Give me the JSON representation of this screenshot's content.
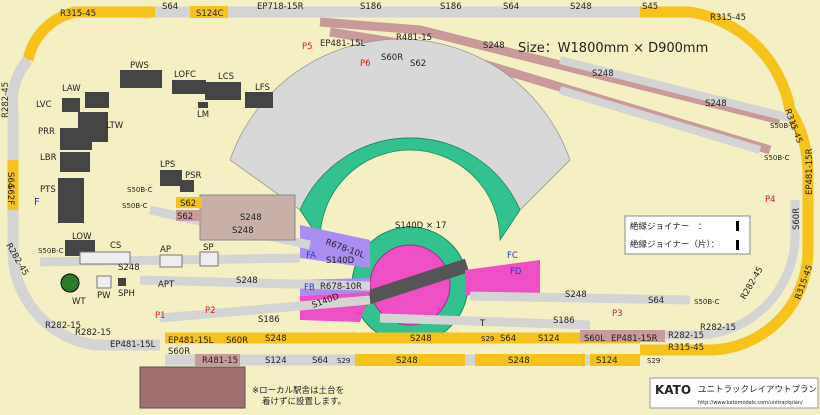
{
  "board": {
    "size_text": "Size：W1800mm × D900mm",
    "note_line1": "※ローカル駅舎は土台を",
    "note_line2": "着けずに設置します。"
  },
  "legend": {
    "joiner_insulated": "絶縁ジョイナー　：",
    "joiner_insulated_one": "絶縁ジョイナー（片）："
  },
  "brand": {
    "logo": "KATO",
    "title": "ユニトラックレイアウトプラン",
    "url": "http://www.katomodels.com/unitrackplan/"
  },
  "track_labels": {
    "r315_tl": "R315-45",
    "s64_top": "S64",
    "s124c": "S124C",
    "ep718": "EP718-15R",
    "s186_top1": "S186",
    "s186_top2": "S186",
    "s64_top2": "S64",
    "s248_top": "S248",
    "s45": "S45",
    "r315_tr": "R315-45",
    "r315_r": "R315-45",
    "r315_br": "R315-45",
    "r282_l": "R282-45",
    "s64_l": "S64",
    "s62f": "S62F",
    "r282_bl": "R282-45",
    "r282_15a": "R282-15",
    "r282_15b": "R282-15",
    "ep481_bl": "EP481-15L",
    "s60r_b": "S60R",
    "r481_b": "R481-15",
    "s124_b": "S124",
    "s64_b": "S64",
    "s29_b": "S29",
    "s248_b1": "S248",
    "s248_b2": "S248",
    "s124_b2": "S124",
    "s29_b2": "S29",
    "s248_mid1": "S248",
    "s248_mid2": "S248",
    "s29_m": "S29",
    "s64_m": "S64",
    "s124_m": "S124",
    "s60l": "S60L",
    "ep481_r": "EP481-15R",
    "r282_15r1": "R282-15",
    "r282_15r2": "R282-15",
    "r282_45r": "R282-45",
    "s60r_r": "S60R",
    "ep481_r2": "EP481-15R",
    "ep481_15l_top": "EP481-15L",
    "r481_top": "R481-15",
    "s60r_top": "S60R",
    "s62_top": "S62",
    "s248_d1": "S248",
    "s248_d2": "S248",
    "s248_d3": "S248",
    "s50bc_r1": "S50B-C",
    "s50bc_r2": "S50B-C",
    "s50bc_l1": "S50B-C",
    "s50bc_l2": "S50B-C",
    "s50bc_l3": "S50B-C",
    "s50bc_rb": "S50B-C",
    "s62_y": "S62",
    "s62_p": "S62",
    "s248_y1": "S248",
    "s248_y2": "S248",
    "s248_y3": "S248",
    "s248_cs": "S248",
    "s186_cs": "S186",
    "s186_r": "S186",
    "s248_r1": "S248",
    "s64_r": "S64",
    "ep481_15l_b": "EP481-15L",
    "s60r_b2": "S60R",
    "r678_10l": "R678-10L",
    "r678_10r": "R678-10R",
    "s140d_1": "S140D",
    "s140d_2": "S140D",
    "turntable": "S140D × 17",
    "fa": "FA",
    "fb": "FB",
    "fc": "FC",
    "fd": "FD",
    "t": "T",
    "f": "F"
  },
  "power_labels": [
    "P1",
    "P2",
    "P3",
    "P4",
    "P5",
    "P6"
  ],
  "structures": {
    "pws": "PWS",
    "lofc": "LOFC",
    "lcs": "LCS",
    "lfs": "LFS",
    "lm": "LM",
    "law": "LAW",
    "lvc": "LVC",
    "ltw": "LTW",
    "prr": "PRR",
    "lbr": "LBR",
    "pts": "PTS",
    "lps": "LPS",
    "psr": "PSR",
    "low": "LOW",
    "cs": "CS",
    "ap": "AP",
    "sp": "SP",
    "apt": "APT",
    "wt": "WT",
    "pw": "PW",
    "sph": "SPH"
  },
  "colors": {
    "board": "#f4f0c4",
    "yellow_track": "#f5c31c",
    "grey_track": "#cfcfcf",
    "rose_track": "#c99a9a",
    "green_fan": "#33c18f",
    "magenta": "#ee4fc4",
    "purple": "#a98df0",
    "grey_fan": "#d8d8d8"
  }
}
